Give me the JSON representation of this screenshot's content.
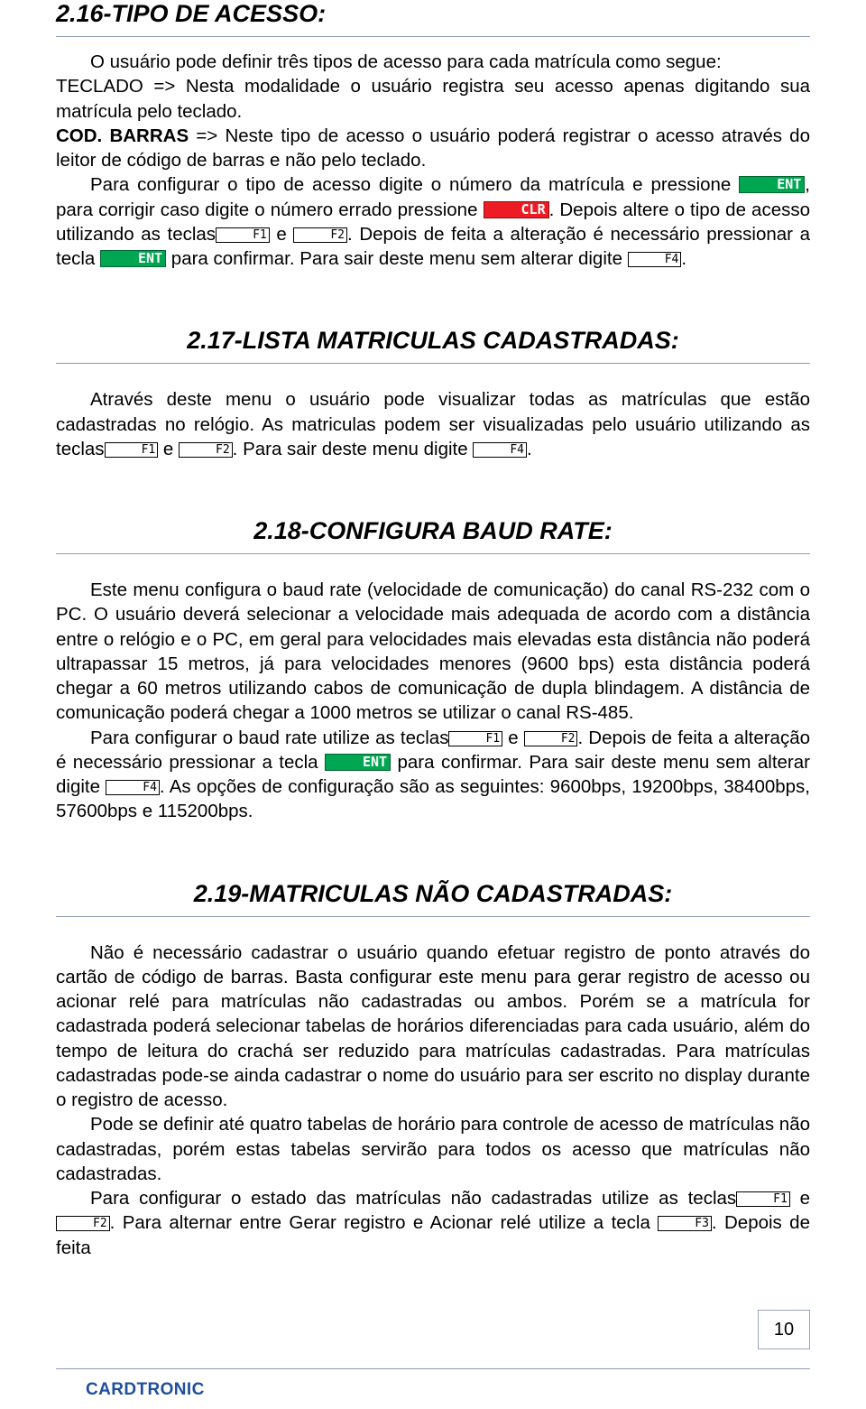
{
  "document": {
    "page_number": "10",
    "footer_brand": "CARDTRONIC"
  },
  "sections": [
    {
      "id": "tipo-de-acesso",
      "title": "2.16-TIPO DE ACESSO:",
      "paragraphs": [
        "O usuário pode definir três tipos de acesso para cada matrícula como segue:",
        "TECLADO => Nesta modalidade o usuário registra seu acesso apenas digitando sua matrícula pelo teclado.",
        "COD. BARRAS => Neste tipo de acesso o usuário poderá registrar o acesso através do leitor de código de barras e não pelo teclado.",
        "Para configurar o tipo de acesso digite o número da matrícula e pressione ENT, para corrigir caso digite o número errado pressione CLR. Depois altere o tipo de acesso utilizando as teclas F1 e F2. Depois de feita a alteração é necessário pressionar a tecla ENT para confirmar. Para sair deste menu sem alterar digite F4."
      ]
    },
    {
      "id": "lista-matriculas",
      "title": "2.17-LISTA MATRICULAS CADASTRADAS:",
      "paragraphs": [
        "Através deste menu o usuário pode visualizar todas as matrículas que estão cadastradas no relógio. As matriculas podem ser visualizadas pelo usuário utilizando as teclas F1 e F2. Para sair deste menu digite F4."
      ]
    },
    {
      "id": "configura-baud-rate",
      "title": "2.18-CONFIGURA BAUD RATE:",
      "paragraphs": [
        "Este menu configura o baud rate (velocidade de comunicação) do canal RS-232 com o PC. O usuário deverá selecionar a velocidade mais adequada de acordo com a distância entre o relógio e o PC, em geral para velocidades mais elevadas esta distância não poderá ultrapassar 15 metros, já para velocidades menores (9600 bps) esta distância poderá chegar a 60 metros utilizando cabos de comunicação de dupla blindagem. A distância de comunicação poderá chegar a 1000 metros se utilizar o canal RS-485.",
        "Para configurar o baud rate utilize as teclas F1 e F2. Depois de feita a alteração é necessário pressionar a tecla ENT para confirmar. Para sair deste menu sem alterar digite F4. As opções de configuração são as seguintes: 9600bps, 19200bps, 38400bps, 57600bps e 115200bps."
      ]
    },
    {
      "id": "matriculas-nao-cadastradas",
      "title": "2.19-MATRICULAS NÃO CADASTRADAS:",
      "paragraphs": [
        "Não é necessário cadastrar o usuário quando efetuar registro de ponto através do cartão de código de barras. Basta configurar este menu para gerar registro de acesso ou acionar relé para matrículas não cadastradas ou ambos. Porém se a matrícula for cadastrada poderá selecionar tabelas de horários diferenciadas para cada usuário, além do tempo de leitura do crachá ser reduzido para matrículas cadastradas. Para matrículas cadastradas pode-se ainda cadastrar o nome do usuário para ser escrito no display durante o registro de acesso.",
        "Pode se definir até quatro tabelas de horário para controle de acesso de matrículas não cadastradas, porém estas tabelas servirão para todos os acesso que matrículas não cadastradas.",
        "Para configurar o estado das matrículas não cadastradas utilize as teclas F1 e F2. Para alternar entre Gerar registro e Acionar relé utilize a tecla F3. Depois de feita"
      ]
    }
  ],
  "keys": {
    "ent": "ENT",
    "clr": "CLR",
    "f1": "F1",
    "f2": "F2",
    "f3": "F3",
    "f4": "F4"
  },
  "labels": {
    "teclado_prefix": "TECLADO",
    "cod_prefix": "COD.",
    "barras_prefix": "BARRAS"
  }
}
